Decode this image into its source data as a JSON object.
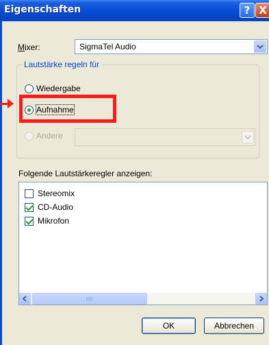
{
  "window": {
    "title": "Eigenschaften",
    "help_button": "?",
    "close_button": "X"
  },
  "mixer": {
    "label_accel": "M",
    "label_rest": "ixer:",
    "value": "SigmaTel Audio"
  },
  "volume_group": {
    "title": "Lautstärke regeln für",
    "options": [
      {
        "label": "Wiedergabe",
        "checked": false,
        "enabled": true
      },
      {
        "label": "Aufnahme",
        "checked": true,
        "enabled": true
      },
      {
        "label": "Andere",
        "checked": false,
        "enabled": false
      }
    ]
  },
  "controls_list": {
    "label": "Folgende Lautstärkeregler anzeigen:",
    "items": [
      {
        "label": "Stereomix",
        "checked": false
      },
      {
        "label": "CD-Audio",
        "checked": true
      },
      {
        "label": "Mikrofon",
        "checked": true
      }
    ]
  },
  "buttons": {
    "ok": "OK",
    "cancel": "Abbrechen"
  },
  "annotation": {
    "highlight_color": "#ff1a1a"
  }
}
